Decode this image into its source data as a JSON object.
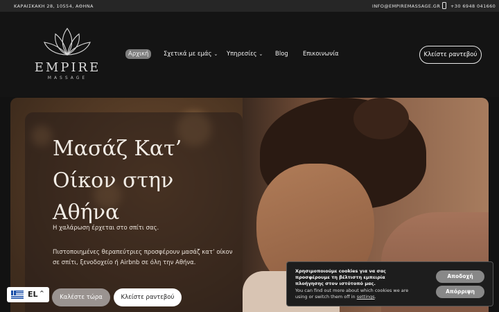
{
  "topbar": {
    "address": "ΚΑΡΑΙΣΚΑΚΗ 28, 10554, ΑΘΗΝΑ",
    "email": "INFO@EMPIREMASSAGE.GR",
    "phone": "+30 6948 041660"
  },
  "logo": {
    "word": "EMPIRE",
    "sub": "MASSAGE"
  },
  "nav": [
    {
      "label": "Αρχική"
    },
    {
      "label": "Σχετικά με εμάς"
    },
    {
      "label": "Υπηρεσίες"
    },
    {
      "label": "Blog"
    },
    {
      "label": "Επικοινωνία"
    }
  ],
  "header_cta": "Κλείστε ραντεβού",
  "hero": {
    "title": "Μασάζ Κατ’ Οίκον στην Αθήνα",
    "subtitle": "Η χαλάρωση έρχεται στο σπίτι σας.",
    "description": "Πιστοποιημένες θεραπεύτριες προσφέρουν μασάζ κατ’ οίκον σε σπίτι, ξενοδοχείο ή Airbnb σε όλη την Αθήνα.",
    "call_button": "Καλέστε τώρα",
    "book_button": "Κλείστε ραντεβού"
  },
  "language": {
    "code": "EL"
  },
  "cookie": {
    "text": "Χρησιμοποιούμε cookies για να σας προσφέρουμε τη βέλτιστη εμπειρία πλοήγησης στον ιστότοπό μας.",
    "more": "You can find out more about which cookies we are using or switch them off in",
    "link": "settings",
    "accept": "Αποδοχή",
    "reject": "Απόρριψη"
  }
}
